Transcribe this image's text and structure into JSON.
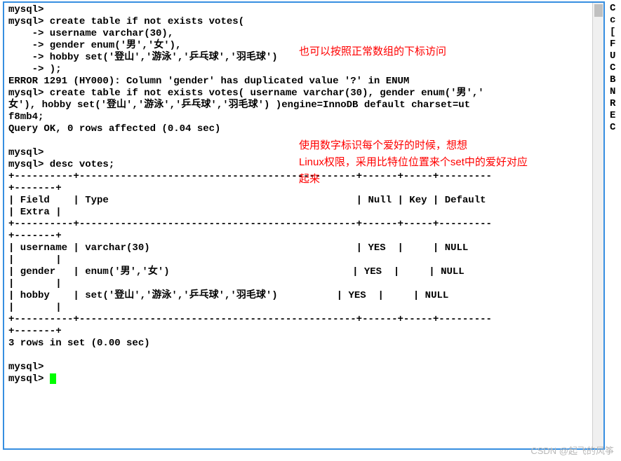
{
  "terminal": {
    "lines": [
      "mysql>",
      "mysql> create table if not exists votes(",
      "    -> username varchar(30),",
      "    -> gender enum('男','女'),",
      "    -> hobby set('登山','游泳','乒乓球','羽毛球')",
      "    -> );",
      "ERROR 1291 (HY000): Column 'gender' has duplicated value '?' in ENUM",
      "mysql> create table if not exists votes( username varchar(30), gender enum('男','",
      "女'), hobby set('登山','游泳','乒乓球','羽毛球') )engine=InnoDB default charset=ut",
      "f8mb4;",
      "Query OK, 0 rows affected (0.04 sec)",
      "",
      "mysql>",
      "mysql> desc votes;",
      "+----------+-----------------------------------------------+------+-----+---------",
      "+-------+",
      "| Field    | Type                                          | Null | Key | Default ",
      "| Extra |",
      "+----------+-----------------------------------------------+------+-----+---------",
      "+-------+",
      "| username | varchar(30)                                   | YES  |     | NULL    ",
      "|       |",
      "| gender   | enum('男','女')                               | YES  |     | NULL    ",
      "|       |",
      "| hobby    | set('登山','游泳','乒乓球','羽毛球')          | YES  |     | NULL    ",
      "|       |",
      "+----------+-----------------------------------------------+------+-----+---------",
      "+-------+",
      "3 rows in set (0.00 sec)",
      "",
      "mysql>",
      "mysql> "
    ],
    "prompt_cursor": " "
  },
  "annotations": {
    "a1": "也可以按照正常数组的下标访问",
    "a2_line1": "使用数字标识每个爱好的时候，想想",
    "a2_line2": "Linux权限，采用比特位位置来个set中的爱好对应",
    "a2_line3": "起来"
  },
  "side": {
    "chars": [
      "",
      "C",
      "c",
      "[",
      "F",
      "",
      "U",
      "",
      "",
      "C",
      "",
      "",
      "",
      "",
      "",
      "",
      "",
      "",
      "",
      "",
      "B",
      "",
      "",
      "N",
      "",
      "R",
      "E",
      "",
      "",
      "",
      "",
      "",
      "C"
    ]
  },
  "watermark": "CSDN @起飞的风筝"
}
